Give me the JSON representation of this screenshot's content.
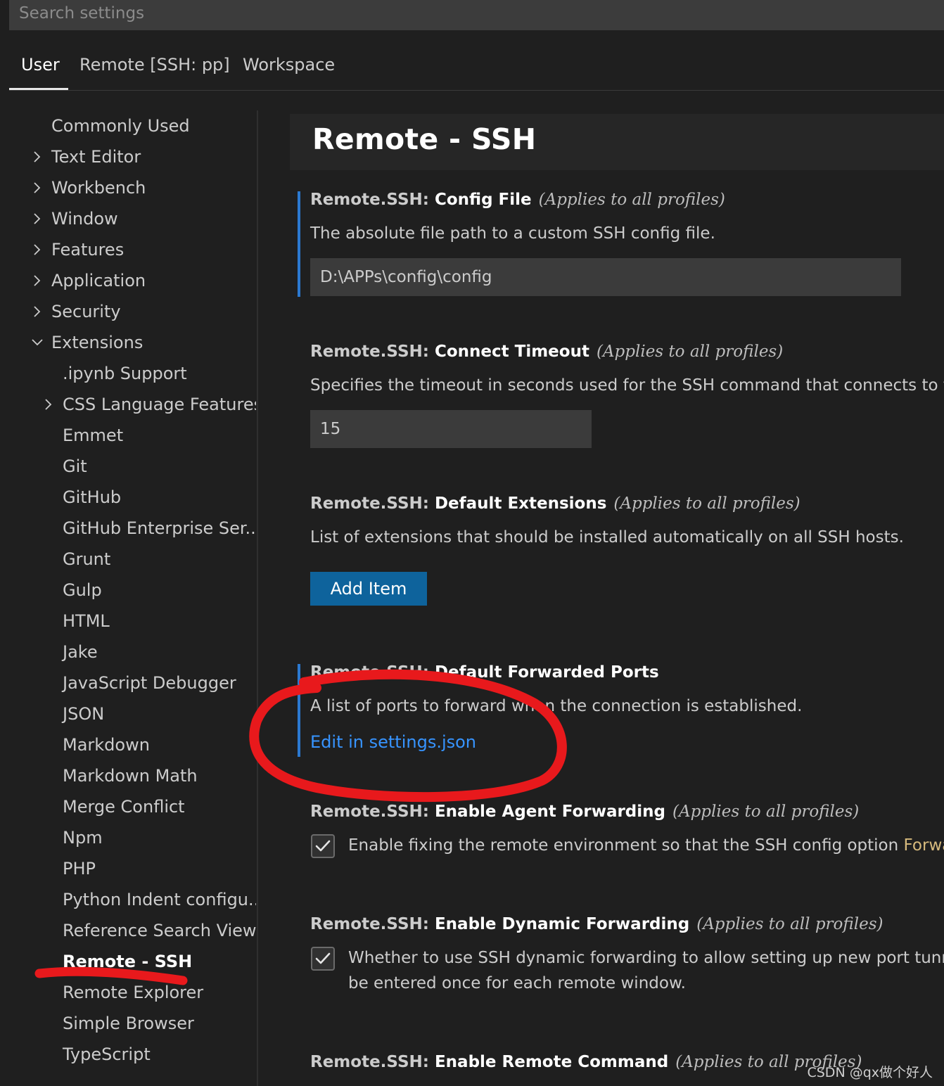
{
  "search": {
    "placeholder": "Search settings",
    "value": ""
  },
  "tabs": [
    {
      "label": "User",
      "active": true
    },
    {
      "label": "Remote [SSH: pp]",
      "active": false
    },
    {
      "label": "Workspace",
      "active": false
    }
  ],
  "sidebar": {
    "items": [
      {
        "label": "Commonly Used"
      },
      {
        "label": "Text Editor",
        "chevron": "chevron-right"
      },
      {
        "label": "Workbench",
        "chevron": "chevron-right"
      },
      {
        "label": "Window",
        "chevron": "chevron-right"
      },
      {
        "label": "Features",
        "chevron": "chevron-right"
      },
      {
        "label": "Application",
        "chevron": "chevron-right"
      },
      {
        "label": "Security",
        "chevron": "chevron-right"
      },
      {
        "label": "Extensions",
        "chevron": "chevron-down"
      },
      {
        "label": ".ipynb Support"
      },
      {
        "label": "CSS Language Features",
        "chevron": "chevron-right"
      },
      {
        "label": "Emmet"
      },
      {
        "label": "Git"
      },
      {
        "label": "GitHub"
      },
      {
        "label": "GitHub Enterprise Ser..."
      },
      {
        "label": "Grunt"
      },
      {
        "label": "Gulp"
      },
      {
        "label": "HTML"
      },
      {
        "label": "Jake"
      },
      {
        "label": "JavaScript Debugger"
      },
      {
        "label": "JSON"
      },
      {
        "label": "Markdown"
      },
      {
        "label": "Markdown Math"
      },
      {
        "label": "Merge Conflict"
      },
      {
        "label": "Npm"
      },
      {
        "label": "PHP"
      },
      {
        "label": "Python Indent configu..."
      },
      {
        "label": "Reference Search View"
      },
      {
        "label": "Remote - SSH",
        "selected": true
      },
      {
        "label": "Remote Explorer"
      },
      {
        "label": "Simple Browser"
      },
      {
        "label": "TypeScript"
      }
    ]
  },
  "main": {
    "section_title": "Remote - SSH",
    "settings": {
      "config_file": {
        "category": "Remote.SSH: ",
        "name": "Config File",
        "scope": "(Applies to all profiles)",
        "description": "The absolute file path to a custom SSH config file.",
        "value": "D:\\APPs\\config\\config"
      },
      "connect_timeout": {
        "category": "Remote.SSH: ",
        "name": "Connect Timeout",
        "scope": "(Applies to all profiles)",
        "description": "Specifies the timeout in seconds used for the SSH command that connects to t",
        "value": "15"
      },
      "default_extensions": {
        "category": "Remote.SSH: ",
        "name": "Default Extensions",
        "scope": "(Applies to all profiles)",
        "description": "List of extensions that should be installed automatically on all SSH hosts.",
        "button_label": "Add Item"
      },
      "default_forwarded_ports": {
        "category": "Remote.SSH: ",
        "name": "Default Forwarded Ports",
        "description": "A list of ports to forward when the connection is established.",
        "link_label": "Edit in settings.json"
      },
      "enable_agent_forwarding": {
        "category": "Remote.SSH: ",
        "name": "Enable Agent Forwarding",
        "scope": "(Applies to all profiles)",
        "checked": true,
        "label": "Enable fixing the remote environment so that the SSH config option ",
        "label_code": "Forwa"
      },
      "enable_dynamic_forwarding": {
        "category": "Remote.SSH: ",
        "name": "Enable Dynamic Forwarding",
        "scope": "(Applies to all profiles)",
        "checked": true,
        "label_line1": "Whether to use SSH dynamic forwarding to allow setting up new port tunr",
        "label_line2": "be entered once for each remote window."
      },
      "enable_remote_command": {
        "category": "Remote.SSH: ",
        "name": "Enable Remote Command",
        "scope": "(Applies to all profiles)"
      }
    }
  },
  "watermark": "CSDN @qx做个好人",
  "colors": {
    "background": "#1f1f1f",
    "accent_blue": "#2b79d0",
    "button_blue": "#0e639c",
    "link_blue": "#3794ff",
    "annotation_red": "#e8191c"
  }
}
